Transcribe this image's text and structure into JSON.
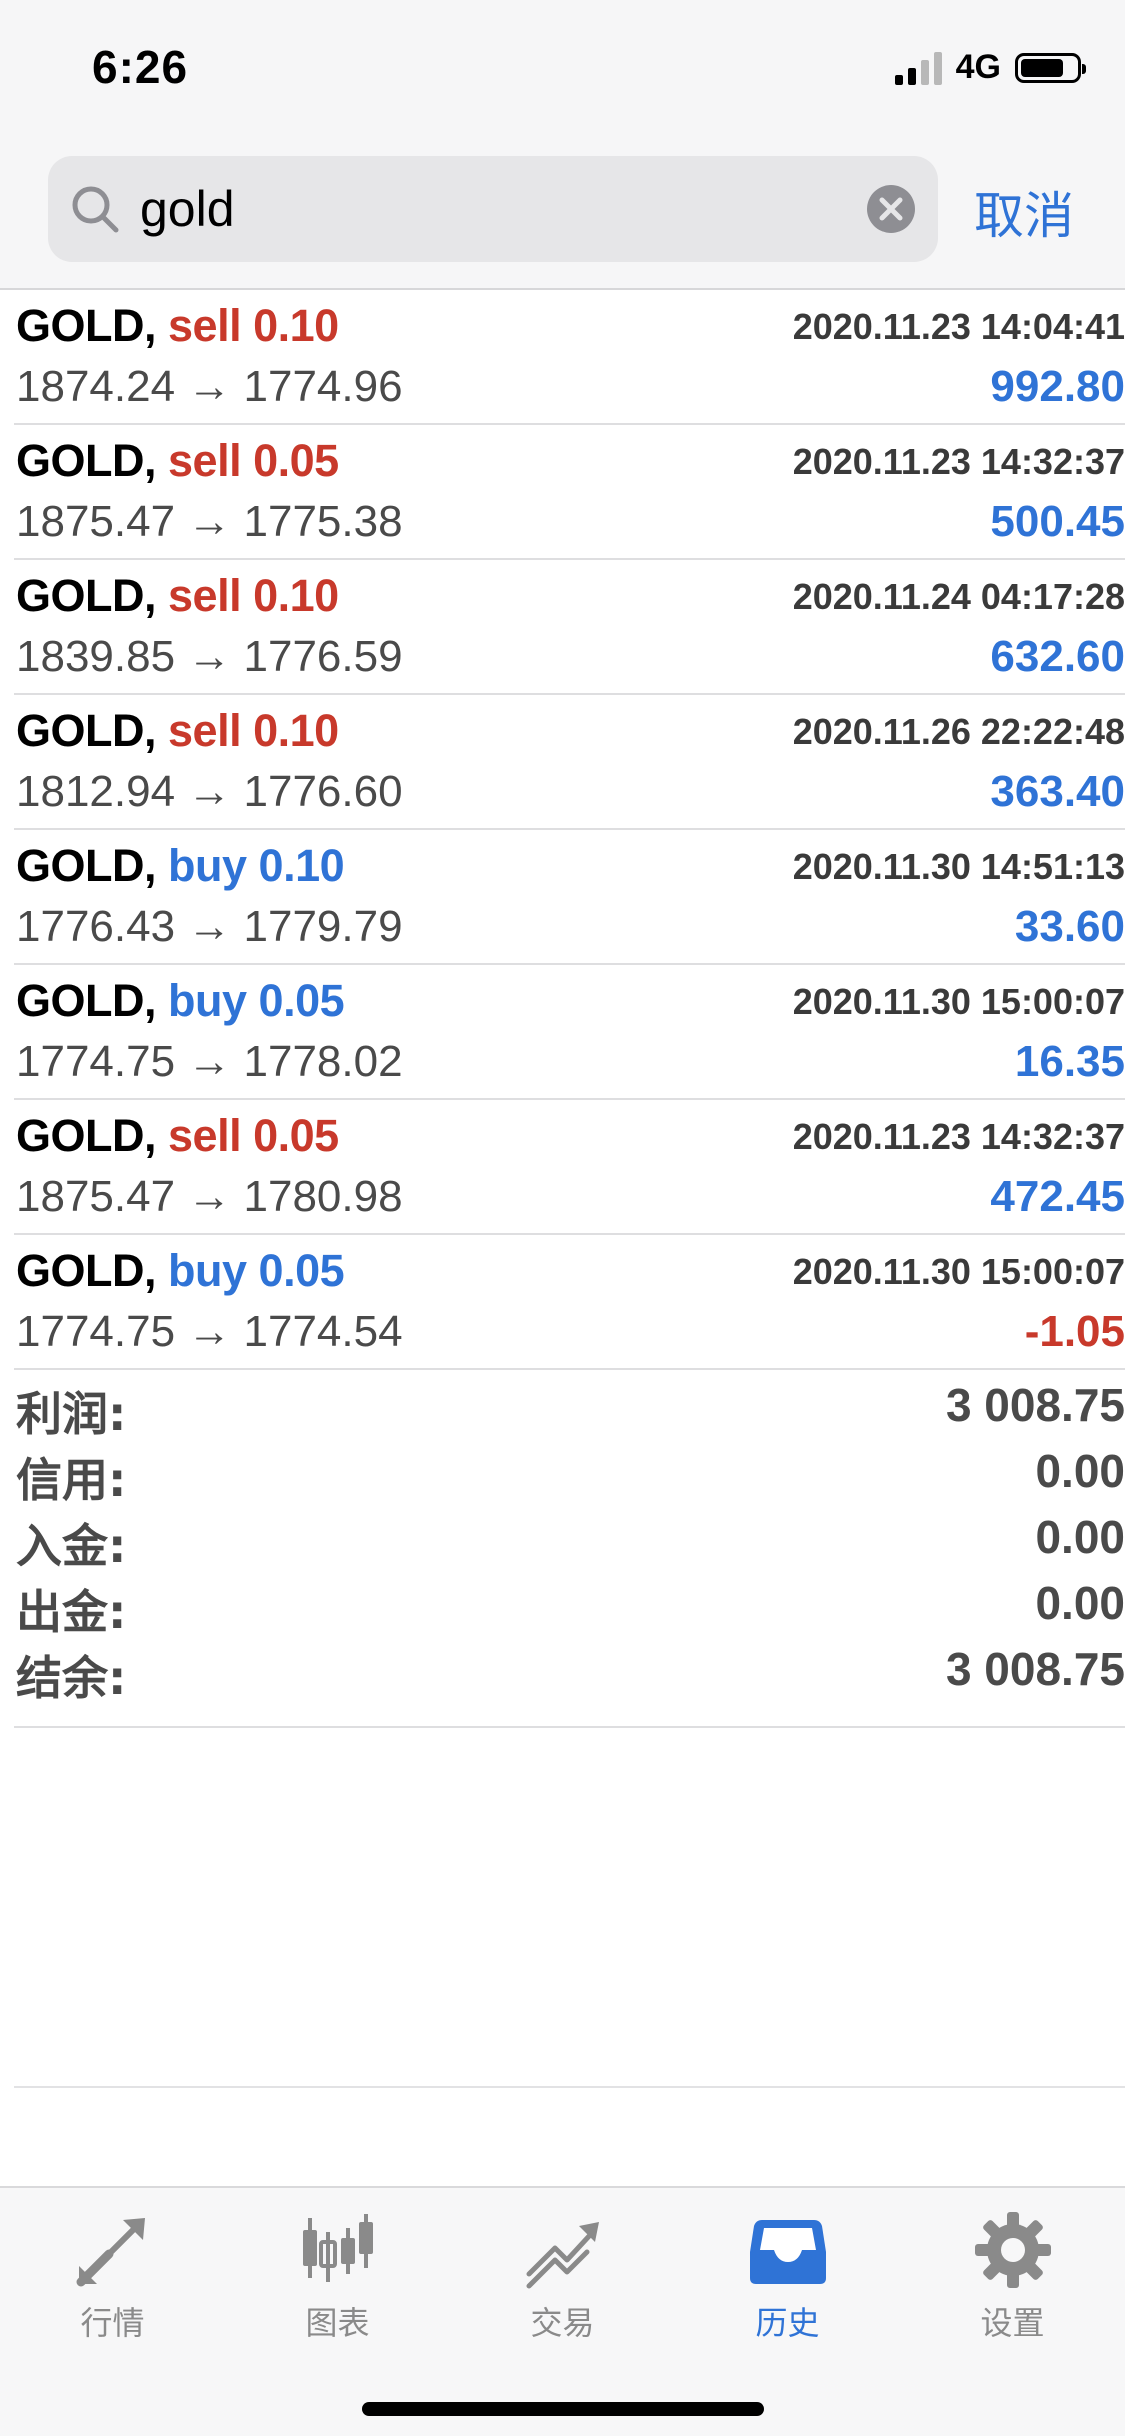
{
  "status_bar": {
    "time": "6:26",
    "network": "4G"
  },
  "search": {
    "value": "gold",
    "cancel_label": "取消"
  },
  "colors": {
    "sell": "#c8392b",
    "buy": "#2f73d6",
    "profit_positive": "#2f73d6",
    "profit_negative": "#c8392b",
    "accent": "#2f73d6"
  },
  "history": [
    {
      "symbol": "GOLD,",
      "type": "sell",
      "volume": "0.10",
      "date": "2020.11.23 14:04:41",
      "prices": "1874.24 → 1774.96",
      "profit": "992.80",
      "profit_sign": "pos"
    },
    {
      "symbol": "GOLD,",
      "type": "sell",
      "volume": "0.05",
      "date": "2020.11.23 14:32:37",
      "prices": "1875.47 → 1775.38",
      "profit": "500.45",
      "profit_sign": "pos"
    },
    {
      "symbol": "GOLD,",
      "type": "sell",
      "volume": "0.10",
      "date": "2020.11.24 04:17:28",
      "prices": "1839.85 → 1776.59",
      "profit": "632.60",
      "profit_sign": "pos"
    },
    {
      "symbol": "GOLD,",
      "type": "sell",
      "volume": "0.10",
      "date": "2020.11.26 22:22:48",
      "prices": "1812.94 → 1776.60",
      "profit": "363.40",
      "profit_sign": "pos"
    },
    {
      "symbol": "GOLD,",
      "type": "buy",
      "volume": "0.10",
      "date": "2020.11.30 14:51:13",
      "prices": "1776.43 → 1779.79",
      "profit": "33.60",
      "profit_sign": "pos"
    },
    {
      "symbol": "GOLD,",
      "type": "buy",
      "volume": "0.05",
      "date": "2020.11.30 15:00:07",
      "prices": "1774.75 → 1778.02",
      "profit": "16.35",
      "profit_sign": "pos"
    },
    {
      "symbol": "GOLD,",
      "type": "sell",
      "volume": "0.05",
      "date": "2020.11.23 14:32:37",
      "prices": "1875.47 → 1780.98",
      "profit": "472.45",
      "profit_sign": "pos"
    },
    {
      "symbol": "GOLD,",
      "type": "buy",
      "volume": "0.05",
      "date": "2020.11.30 15:00:07",
      "prices": "1774.75 → 1774.54",
      "profit": "-1.05",
      "profit_sign": "neg"
    }
  ],
  "summary": [
    {
      "label": "利润:",
      "value": "3 008.75"
    },
    {
      "label": "信用:",
      "value": "0.00"
    },
    {
      "label": "入金:",
      "value": "0.00"
    },
    {
      "label": "出金:",
      "value": "0.00"
    },
    {
      "label": "结余:",
      "value": "3 008.75"
    }
  ],
  "tabs": [
    {
      "label": "行情",
      "icon": "quotes-arrows-icon",
      "active": false
    },
    {
      "label": "图表",
      "icon": "candlestick-chart-icon",
      "active": false
    },
    {
      "label": "交易",
      "icon": "trade-trend-icon",
      "active": false
    },
    {
      "label": "历史",
      "icon": "history-inbox-icon",
      "active": true
    },
    {
      "label": "设置",
      "icon": "gear-icon",
      "active": false
    }
  ]
}
